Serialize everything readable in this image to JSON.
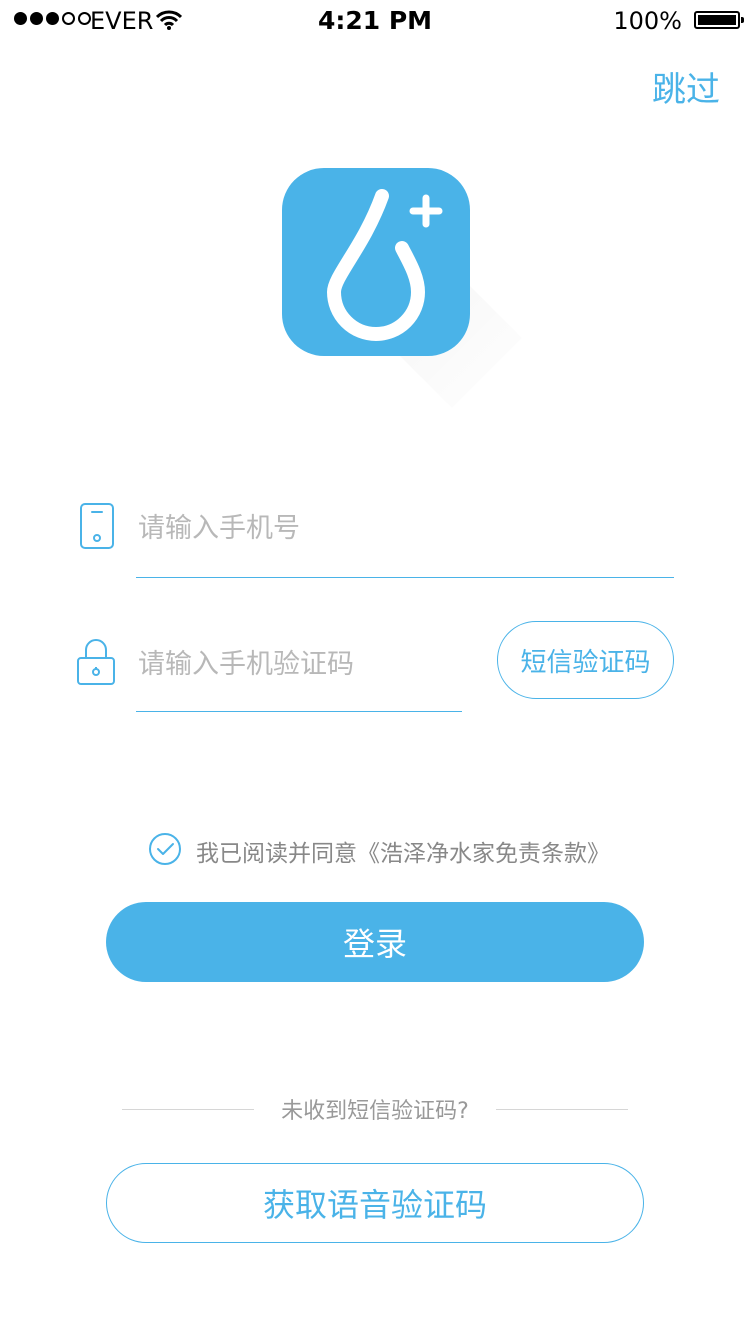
{
  "status_bar": {
    "carrier": "EVER",
    "time": "4:21 PM",
    "battery": "100%"
  },
  "header": {
    "skip_label": "跳过"
  },
  "form": {
    "phone_placeholder": "请输入手机号",
    "code_placeholder": "请输入手机验证码",
    "sms_button_label": "短信验证码"
  },
  "agreement": {
    "text": "我已阅读并同意《浩泽净水家免责条款》",
    "checked": true
  },
  "login_button_label": "登录",
  "footer": {
    "hint": "未收到短信验证码?",
    "voice_button_label": "获取语音验证码"
  },
  "colors": {
    "accent": "#4ab3e8"
  }
}
